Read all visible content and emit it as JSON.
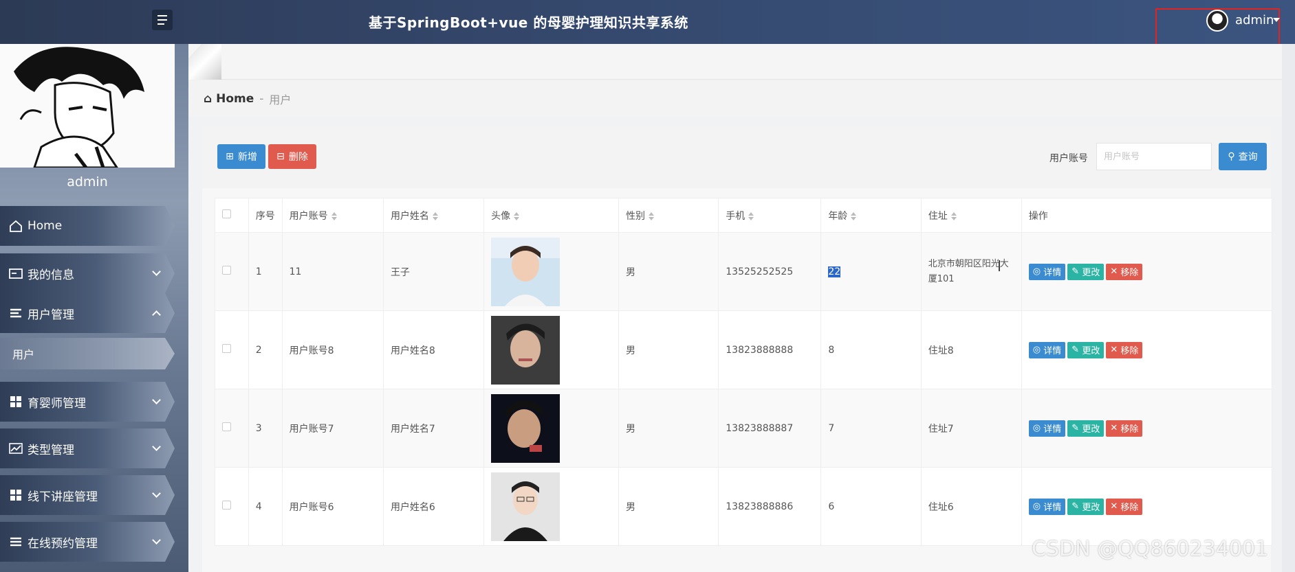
{
  "header": {
    "title": "基于SpringBoot+vue 的母婴护理知识共享系统",
    "user": "admin",
    "colors": {
      "accent": "#3a8bd0",
      "danger": "#e05b4d",
      "success": "#2bb3a3"
    }
  },
  "sidebar": {
    "profile_name": "admin",
    "items": [
      {
        "label": "Home",
        "icon": "home-icon"
      },
      {
        "label": "我的信息",
        "icon": "id-card-icon"
      },
      {
        "label": "用户管理",
        "icon": "list-icon",
        "expanded": true
      },
      {
        "label": "用户",
        "icon": "",
        "sub": true
      },
      {
        "label": "育婴师管理",
        "icon": "grid-icon"
      },
      {
        "label": "类型管理",
        "icon": "chart-icon"
      },
      {
        "label": "线下讲座管理",
        "icon": "grid-icon"
      },
      {
        "label": "在线预约管理",
        "icon": "list-icon"
      }
    ]
  },
  "breadcrumb": {
    "home": "Home",
    "separator": "-",
    "current": "用户"
  },
  "toolbar": {
    "add_label": "新增",
    "delete_label": "删除",
    "search_label": "用户账号",
    "search_placeholder": "用户账号",
    "search_button": "查询"
  },
  "table": {
    "headers": [
      "序号",
      "用户账号",
      "用户姓名",
      "头像",
      "性别",
      "手机",
      "年龄",
      "住址",
      "操作"
    ],
    "rows": [
      {
        "no": "1",
        "account": "11",
        "name": "王子",
        "gender": "男",
        "phone": "13525252525",
        "age": "22",
        "address": "北京市朝阳区阳光大厦101"
      },
      {
        "no": "2",
        "account": "用户账号8",
        "name": "用户姓名8",
        "gender": "男",
        "phone": "13823888888",
        "age": "8",
        "address": "住址8"
      },
      {
        "no": "3",
        "account": "用户账号7",
        "name": "用户姓名7",
        "gender": "男",
        "phone": "13823888887",
        "age": "7",
        "address": "住址7"
      },
      {
        "no": "4",
        "account": "用户账号6",
        "name": "用户姓名6",
        "gender": "男",
        "phone": "13823888886",
        "age": "6",
        "address": "住址6"
      }
    ],
    "actions": {
      "detail": "详情",
      "edit": "更改",
      "remove": "移除"
    }
  },
  "watermark": "CSDN @QQ860234001"
}
